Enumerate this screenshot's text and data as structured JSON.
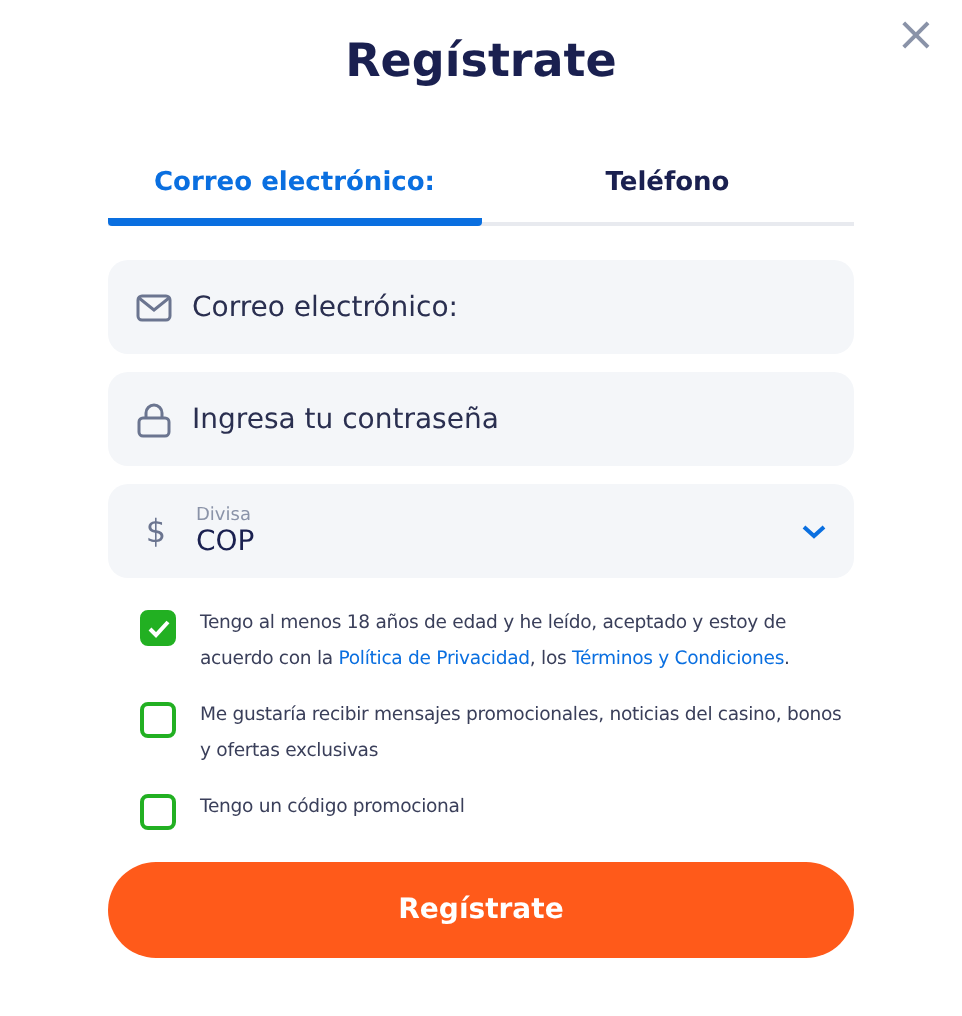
{
  "title": "Regístrate",
  "close": "×",
  "tabs": [
    {
      "label": "Correo electrónico:",
      "selected": true
    },
    {
      "label": "Teléfono",
      "selected": false
    }
  ],
  "fields": [
    {
      "kind": "email",
      "placeholder": "Correo electrónico:"
    },
    {
      "kind": "password",
      "placeholder": "Ingresa tu contraseña"
    },
    {
      "kind": "currency",
      "icon": "$",
      "label": "Divisa",
      "value": "COP"
    }
  ],
  "checkboxes": [
    {
      "checked": true,
      "parts": [
        {
          "kind": "text",
          "text": "Tengo al menos 18 años de edad y he leído, aceptado y estoy de acuerdo con la "
        },
        {
          "kind": "link",
          "text": "Política de Privacidad"
        },
        {
          "kind": "text",
          "text": ", los "
        },
        {
          "kind": "link",
          "text": "Términos y Condiciones"
        },
        {
          "kind": "text",
          "text": "."
        }
      ]
    },
    {
      "checked": false,
      "parts": [
        {
          "kind": "text",
          "text": "Me gustaría recibir mensajes promocionales, noticias del casino, bonos y ofertas exclusivas"
        }
      ]
    },
    {
      "checked": false,
      "parts": [
        {
          "kind": "text",
          "text": "Tengo un código promocional"
        }
      ]
    }
  ],
  "submit": "Regístrate"
}
